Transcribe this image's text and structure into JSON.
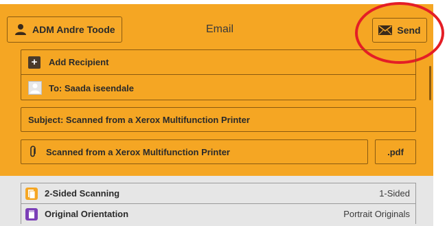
{
  "header": {
    "user_label": "ADM Andre Toode",
    "title": "Email",
    "send_label": "Send",
    "user_icon": "user-icon",
    "send_icon": "envelope-icon"
  },
  "recipients": {
    "add_label": "Add Recipient",
    "to_label": "To: Saada iseendale"
  },
  "subject": {
    "label": "Subject: Scanned from a Xerox Multifunction Printer"
  },
  "attachment": {
    "name": "Scanned from a Xerox Multifunction Printer",
    "extension": ".pdf"
  },
  "options": [
    {
      "label": "2-Sided Scanning",
      "value": "1-Sided"
    },
    {
      "label": "Original Orientation",
      "value": "Portrait Originals"
    }
  ],
  "colors": {
    "accent": "#f5a623",
    "highlight": "#e41e26",
    "orientation_icon": "#7b3fb7"
  }
}
